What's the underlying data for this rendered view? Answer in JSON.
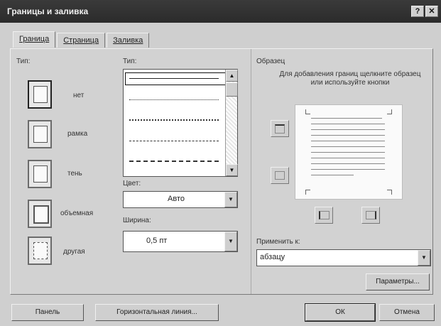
{
  "window": {
    "title": "Границы и заливка",
    "help": "?",
    "close": "✕"
  },
  "tabs": [
    {
      "label": "Граница",
      "active": true
    },
    {
      "label": "Страница",
      "active": false
    },
    {
      "label": "Заливка",
      "active": false
    }
  ],
  "type_section": {
    "label": "Тип:",
    "items": [
      {
        "label": "нет"
      },
      {
        "label": "рамка"
      },
      {
        "label": "тень"
      },
      {
        "label": "объемная"
      },
      {
        "label": "другая"
      }
    ]
  },
  "style_section": {
    "label": "Тип:"
  },
  "color": {
    "label": "Цвет:",
    "value": "Авто"
  },
  "width": {
    "label": "Ширина:",
    "value": "0,5 пт"
  },
  "sample": {
    "label": "Образец",
    "hint": "Для добавления границ щелкните образец или используйте кнопки"
  },
  "apply_to": {
    "label": "Применить к:",
    "value": "абзацу"
  },
  "buttons": {
    "params": "Параметры...",
    "toolbar": "Панель",
    "hline": "Горизонтальная линия...",
    "ok": "ОК",
    "cancel": "Отмена"
  }
}
